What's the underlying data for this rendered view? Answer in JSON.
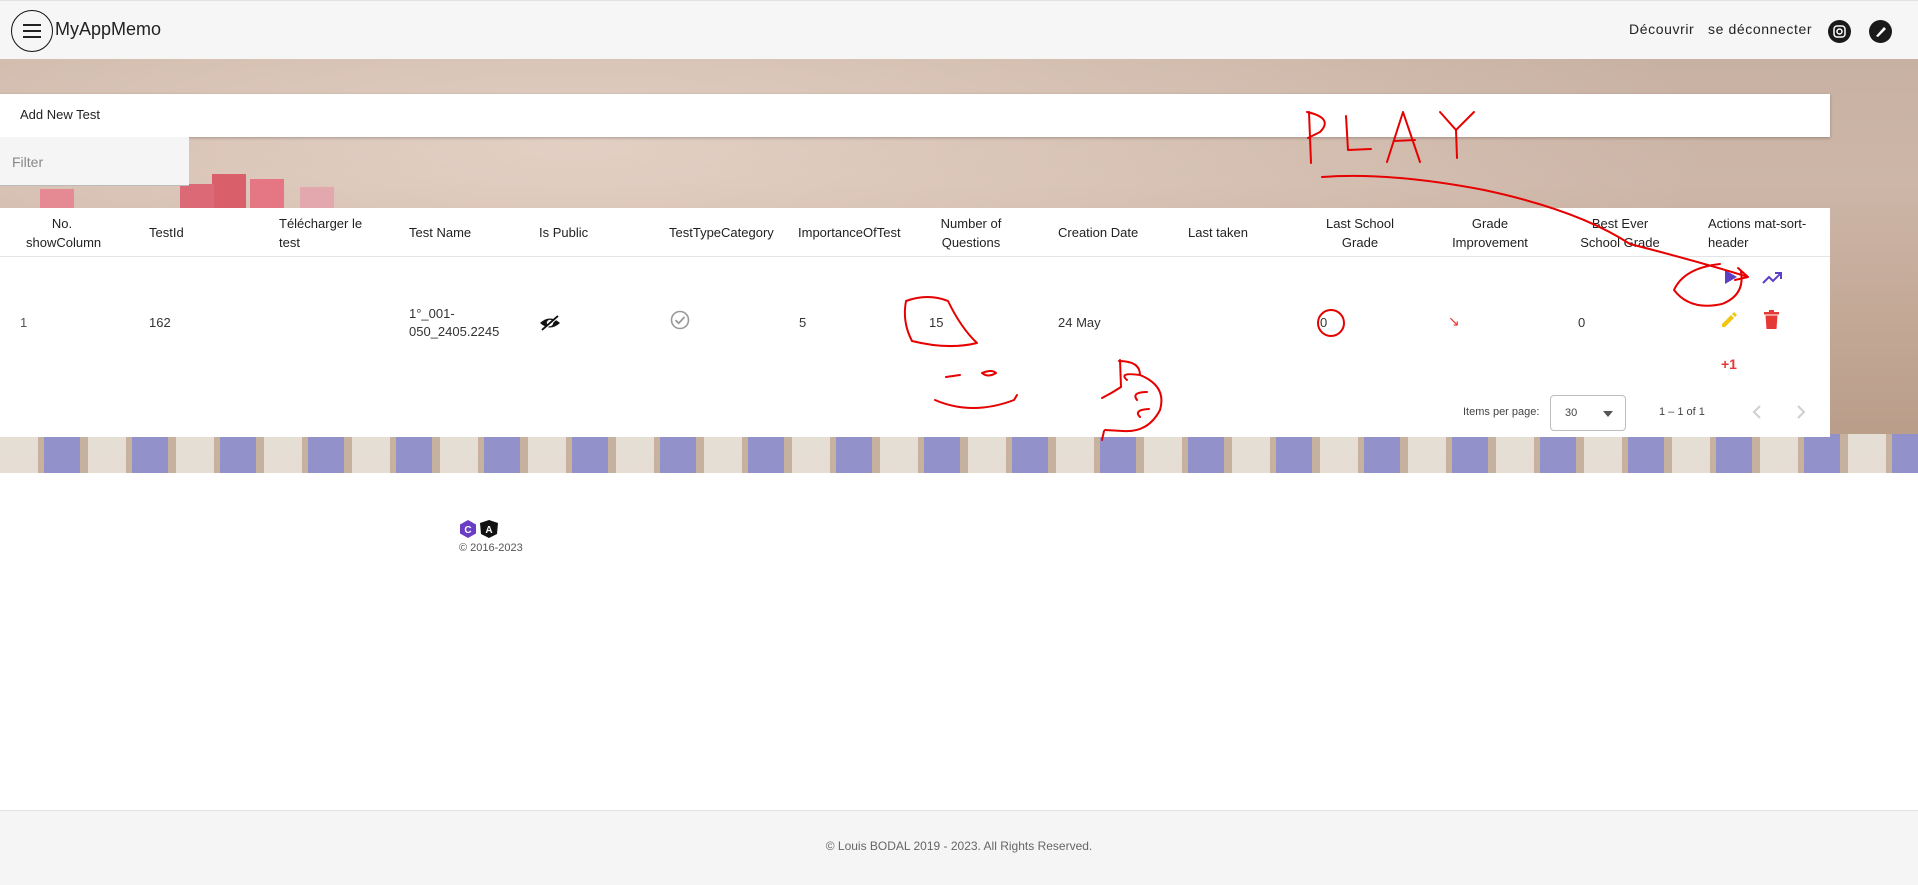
{
  "app": {
    "title": "MyAppMemo"
  },
  "nav": {
    "discover": "Découvrir",
    "logout": "se déconnecter"
  },
  "actions": {
    "add_new": "Add New Test"
  },
  "filter": {
    "placeholder": "Filter"
  },
  "table": {
    "headers": {
      "no": [
        "No.",
        "showColumn"
      ],
      "test_id": "TestId",
      "download": [
        "Télécharger le",
        "test"
      ],
      "test_name": "Test Name",
      "is_public": "Is Public",
      "category": "TestTypeCategory",
      "importance": "ImportanceOfTest",
      "num_questions": [
        "Number of",
        "Questions"
      ],
      "creation_date": "Creation Date",
      "last_taken": "Last taken",
      "last_grade": [
        "Last School",
        "Grade"
      ],
      "improvement": [
        "Grade",
        "Improvement"
      ],
      "best_grade": [
        "Best Ever",
        "School Grade"
      ],
      "actions": [
        "Actions mat-sort-",
        "header"
      ]
    },
    "rows": [
      {
        "no": "1",
        "test_id": "162",
        "test_name": [
          "1°_001-",
          "050_2405.2245"
        ],
        "importance": "5",
        "num_questions": "15",
        "creation_date": "24 May",
        "last_grade": "0",
        "improvement_icon": "↘",
        "best_grade": "0",
        "plus_one": "+1"
      }
    ]
  },
  "paginator": {
    "label": "Items per page:",
    "page_size": "30",
    "range": "1 – 1 of 1"
  },
  "footer": {
    "copyright": "© 2016-2023",
    "bottom": "© Louis BODAL 2019 - 2023. All Rights Reserved."
  },
  "annotations": {
    "play_text": "PLAY"
  },
  "colors": {
    "accent": "#5c3fc4",
    "danger": "#e53935",
    "edit": "#f2c510",
    "annotation": "#e60000"
  }
}
